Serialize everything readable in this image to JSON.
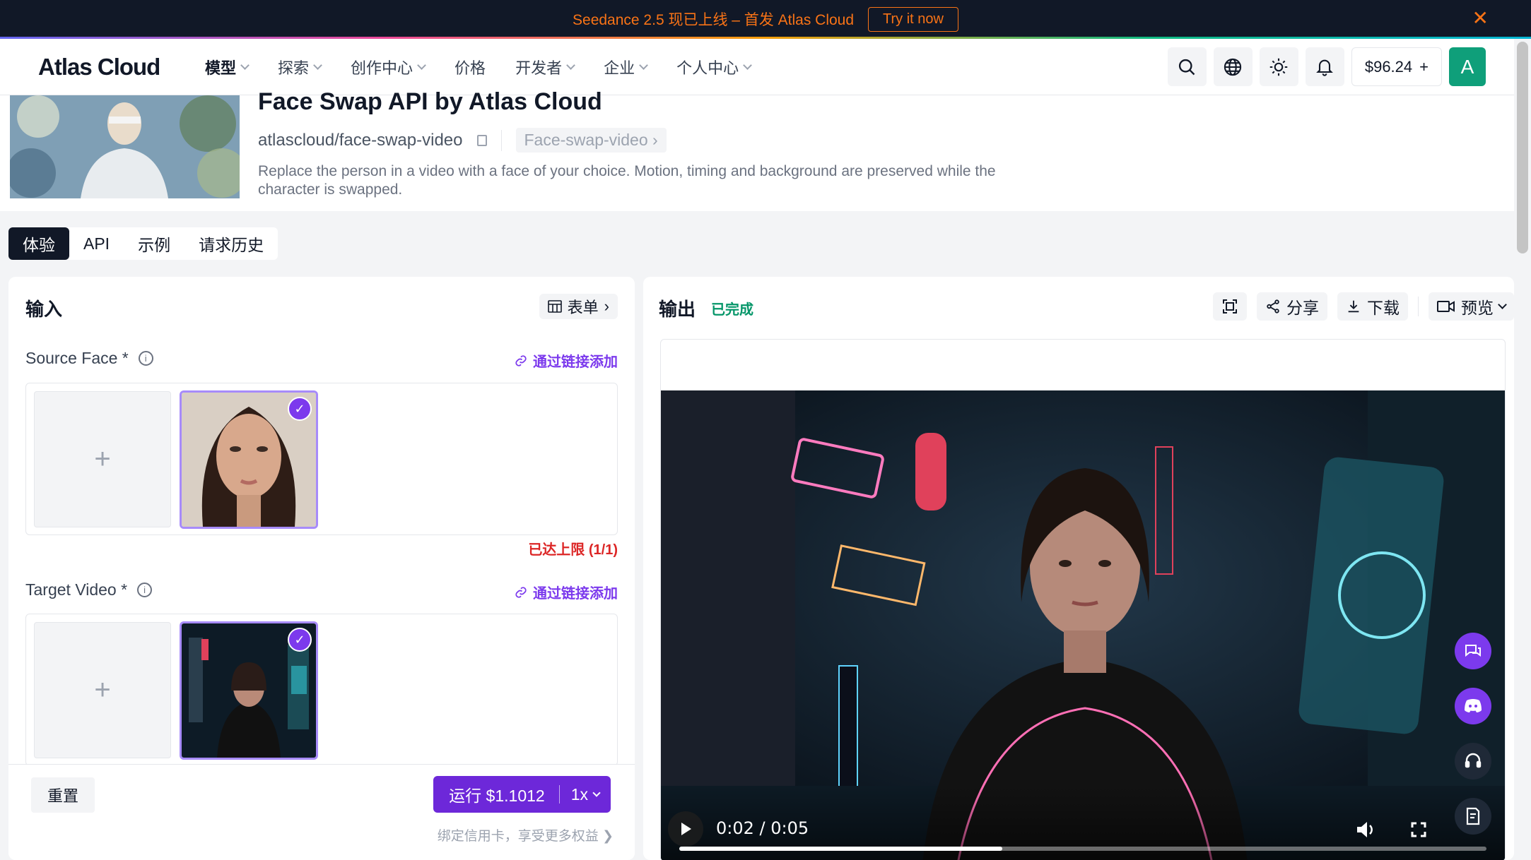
{
  "banner": {
    "text": "Seedance 2.5 现已上线 – 首发 Atlas Cloud",
    "cta": "Try it now",
    "close": "✕"
  },
  "header": {
    "logo": "Atlas Cloud",
    "nav": [
      {
        "label": "模型",
        "dropdown": true,
        "active": true
      },
      {
        "label": "探索",
        "dropdown": true
      },
      {
        "label": "创作中心",
        "dropdown": true
      },
      {
        "label": "价格",
        "dropdown": false
      },
      {
        "label": "开发者",
        "dropdown": true
      },
      {
        "label": "企业",
        "dropdown": true
      },
      {
        "label": "个人中心",
        "dropdown": true
      }
    ],
    "balance": "$96.24",
    "balance_add": "+",
    "avatar_letter": "A",
    "icons": [
      "search-icon",
      "globe-icon",
      "sun-icon",
      "bell-icon"
    ]
  },
  "model": {
    "title": "Face Swap API by Atlas Cloud",
    "path": "atlascloud/face-swap-video",
    "tag": "Face-swap-video",
    "description": "Replace the person in a video with a face of your choice. Motion, timing and background are preserved while the character is swapped."
  },
  "tabs": [
    {
      "label": "体验",
      "active": true
    },
    {
      "label": "API"
    },
    {
      "label": "示例"
    },
    {
      "label": "请求历史"
    }
  ],
  "input": {
    "title": "输入",
    "form_label": "表单",
    "source_face": {
      "label": "Source Face *",
      "link_add": "通过链接添加",
      "limit": "已达上限 (1/1)"
    },
    "target_video": {
      "label": "Target Video *",
      "link_add": "通过链接添加"
    },
    "reset": "重置",
    "run_label": "运行 $1.1012",
    "run_multiplier": "1x",
    "card_hint": "绑定信用卡，享受更多权益 ❯"
  },
  "output": {
    "title": "输出",
    "status": "已完成",
    "actions": {
      "share": "分享",
      "download": "下载",
      "preview": "预览"
    },
    "video": {
      "time": "0:02 / 0:05",
      "progress": 0.4
    }
  },
  "colors": {
    "accent": "#6d28d9",
    "banner_bg": "#111827",
    "banner_text": "#f97316",
    "success": "#059669",
    "limit": "#dc2626"
  }
}
